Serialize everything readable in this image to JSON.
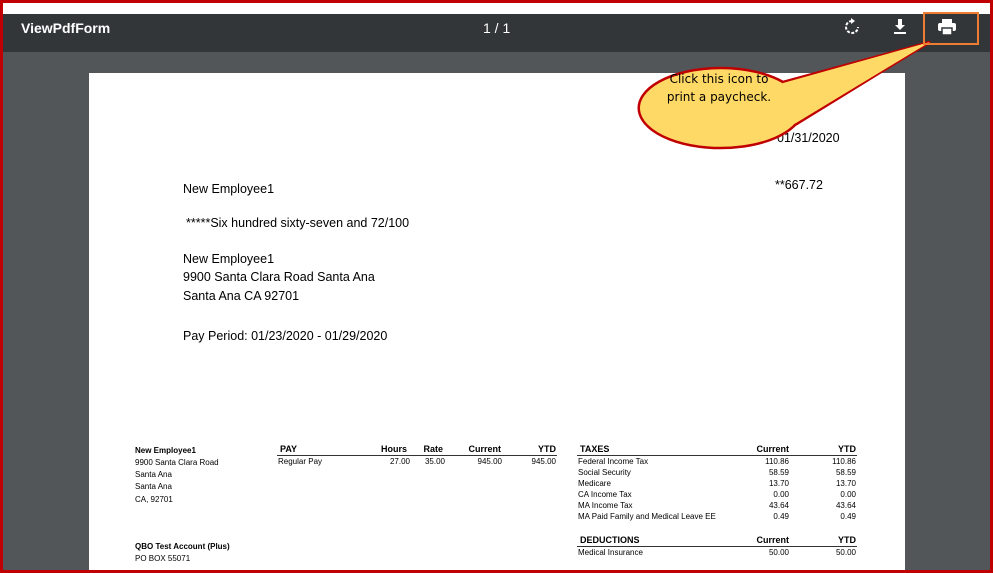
{
  "toolbar": {
    "title": "ViewPdfForm",
    "page_indicator": "1 / 1",
    "icons": [
      "rotate-icon",
      "download-icon",
      "print-icon"
    ]
  },
  "callout": {
    "text": "Click this icon to print a paycheck."
  },
  "check": {
    "date": "01/31/2020",
    "payee": "New Employee1",
    "amount": "**667.72",
    "amount_words": "*****Six hundred sixty-seven and 72/100",
    "address": [
      "New Employee1",
      "9900 Santa Clara Road Santa Ana",
      "Santa Ana CA 92701"
    ],
    "pay_period": "Pay Period:  01/23/2020 - 01/29/2020"
  },
  "stub": {
    "employee": {
      "name": "New Employee1",
      "lines": [
        "9900 Santa Clara Road",
        "Santa Ana",
        "Santa Ana",
        "CA, 92701"
      ]
    },
    "company": {
      "name": "QBO Test Account (Plus)",
      "line": "PO BOX 55071"
    },
    "pay": {
      "headers": [
        "PAY",
        "Hours",
        "Rate",
        "Current",
        "YTD"
      ],
      "rows": [
        [
          "Regular Pay",
          "27.00",
          "35.00",
          "945.00",
          "945.00"
        ]
      ]
    },
    "taxes": {
      "headers": [
        "TAXES",
        "Current",
        "YTD"
      ],
      "rows": [
        [
          "Federal Income Tax",
          "110.86",
          "110.86"
        ],
        [
          "Social Security",
          "58.59",
          "58.59"
        ],
        [
          "Medicare",
          "13.70",
          "13.70"
        ],
        [
          "CA Income Tax",
          "0.00",
          "0.00"
        ],
        [
          "MA Income Tax",
          "43.64",
          "43.64"
        ],
        [
          "MA Paid Family and Medical Leave EE",
          "0.49",
          "0.49"
        ]
      ]
    },
    "deductions": {
      "headers": [
        "DEDUCTIONS",
        "Current",
        "YTD"
      ],
      "rows": [
        [
          "Medical Insurance",
          "50.00",
          "50.00"
        ]
      ]
    }
  }
}
